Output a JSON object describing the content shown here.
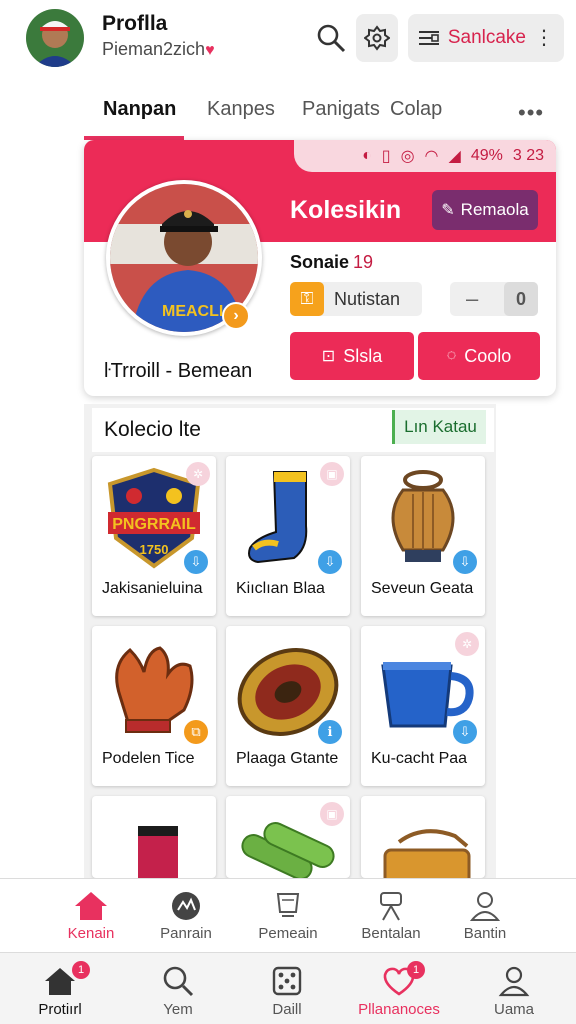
{
  "header": {
    "user_name": "Proflla",
    "user_handle": "Pieman2zich",
    "heart": "♥",
    "pill_label": "Sanlcake"
  },
  "tabs": [
    {
      "label": "Nanpan",
      "active": true
    },
    {
      "label": "Kanpes",
      "active": false
    },
    {
      "label": "Panigats",
      "active": false
    },
    {
      "label": "Colap",
      "active": false
    }
  ],
  "tabs_more": "•••",
  "status_bar": {
    "battery": "49%",
    "time": "3 23"
  },
  "profile": {
    "card_title": "Kolesikin",
    "edit_label": "Remaola",
    "sub_label": "Sonaie",
    "sub_number": "19",
    "chip_label": "Nutistan",
    "stepper_minus": "–",
    "stepper_value": "0",
    "button_primary": "Slsla",
    "button_secondary": "Coolo",
    "full_name": "ŀTrroill - Bemean"
  },
  "collection": {
    "title": "Kolecio lte",
    "link_label": "Lın Katau",
    "items": [
      {
        "label": "Jakisanieluina",
        "icon": "crest-badge-icon"
      },
      {
        "label": "Kiıclıan Blaa",
        "icon": "sock-icon"
      },
      {
        "label": "Seveun Geata",
        "icon": "urn-icon"
      },
      {
        "label": "Podelen Tice",
        "icon": "glove-icon"
      },
      {
        "label": "Plaaga Gtante",
        "icon": "disc-icon"
      },
      {
        "label": "Ku-cacht Paa",
        "icon": "mug-icon"
      },
      {
        "label": "",
        "icon": "bag-icon"
      },
      {
        "label": "",
        "icon": "rolls-icon"
      },
      {
        "label": "",
        "icon": "satchel-icon"
      }
    ]
  },
  "category_nav": [
    {
      "label": "Kenain",
      "icon": "home-icon",
      "active": true
    },
    {
      "label": "Panrain",
      "icon": "chart-circle-icon",
      "active": false
    },
    {
      "label": "Pemeain",
      "icon": "trophy-icon",
      "active": false
    },
    {
      "label": "Bentalan",
      "icon": "figure-icon",
      "active": false
    },
    {
      "label": "Bantin",
      "icon": "person-icon",
      "active": false
    }
  ],
  "main_nav": [
    {
      "label": "Protiırl",
      "icon": "home-icon",
      "badge": "1"
    },
    {
      "label": "Yem",
      "icon": "search-icon",
      "badge": ""
    },
    {
      "label": "Daill",
      "icon": "dice-icon",
      "badge": ""
    },
    {
      "label": "Pllananoces",
      "icon": "heart-icon",
      "badge": "1"
    },
    {
      "label": "Uama",
      "icon": "person-icon",
      "badge": ""
    }
  ],
  "colors": {
    "accent": "#ec2b57",
    "accent_dark": "#7a2d6e",
    "chip_orange": "#f6a21c",
    "pin_blue": "#3fa0e6",
    "link_green": "#4caf50"
  }
}
